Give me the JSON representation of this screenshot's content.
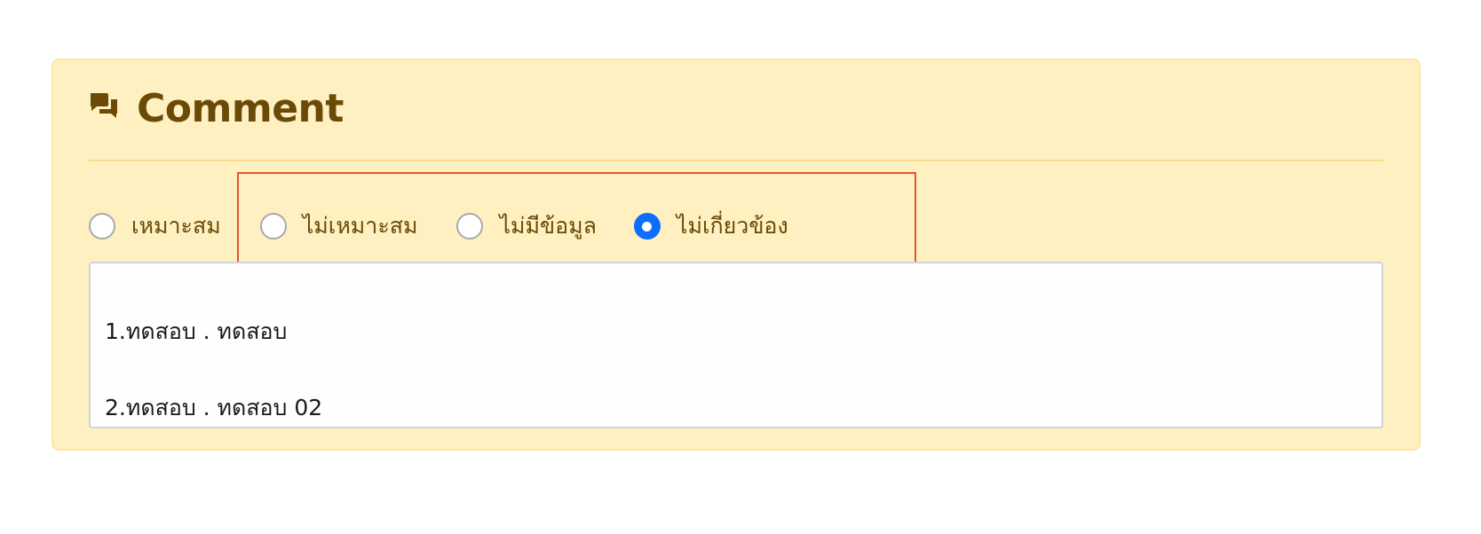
{
  "comment_panel": {
    "title": "Comment",
    "title_icon": "comments-icon",
    "colors": {
      "panel_background": "#fff0c2",
      "title_text": "#6a4a06",
      "radio_selected": "#0d6efd",
      "highlight_border": "#e8542a"
    },
    "options": [
      {
        "label": "เหมาะสม",
        "checked": false
      },
      {
        "label": "ไม่เหมาะสม",
        "checked": false
      },
      {
        "label": "ไม่มีข้อมูล",
        "checked": false
      },
      {
        "label": "ไม่เกี่ยวข้อง",
        "checked": true
      }
    ],
    "comment_text": {
      "lines": [
        "1.ทดสอบ . ทดสอบ",
        "2.ทดสอบ . ทดสอบ 02"
      ]
    }
  }
}
